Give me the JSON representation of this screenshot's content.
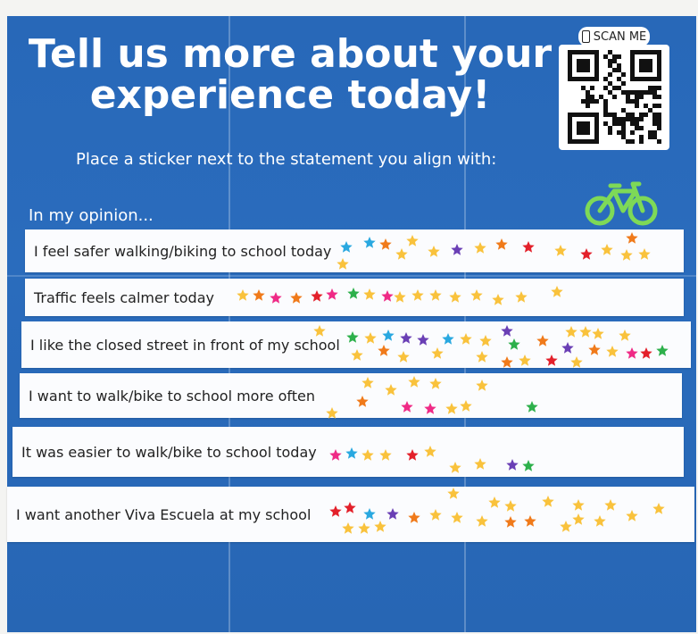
{
  "poster": {
    "title": "Tell us more about your experience today!",
    "scan_label": "SCAN ME",
    "subtitle": "Place a sticker next to the statement you align with:",
    "opinion_label": "In my opinion...",
    "statements": [
      {
        "text": "I feel safer walking/biking to school today"
      },
      {
        "text": "Traffic feels calmer today"
      },
      {
        "text": "I like the closed street in front of my school"
      },
      {
        "text": "I want to walk/bike to school more often"
      },
      {
        "text": "It was easier to walk/bike to school today"
      },
      {
        "text": "I want another Viva Escuela at my school"
      }
    ]
  },
  "colors": {
    "background": "#2a6cbd",
    "row": "#fbfcfe",
    "bike": "#7ed957",
    "stars": [
      "#f9c23c",
      "#f07a1a",
      "#e3202a",
      "#2db04b",
      "#29a8e0",
      "#6a3fb5",
      "#ef2a86"
    ]
  },
  "icons": [
    "phone-icon",
    "qr-code",
    "bicycle-icon",
    "star-sticker"
  ]
}
